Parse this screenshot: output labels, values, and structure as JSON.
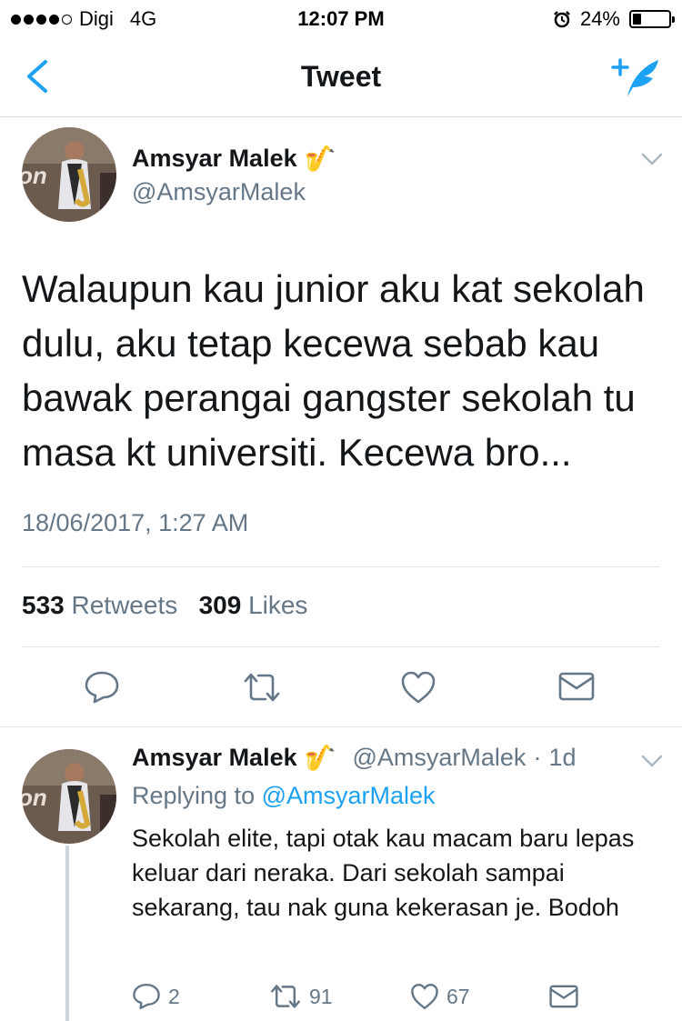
{
  "status_bar": {
    "carrier": "Digi",
    "network": "4G",
    "time": "12:07 PM",
    "battery_percent": "24%",
    "battery_level": 0.24,
    "signal_bars_filled": 4,
    "signal_bars_total": 5
  },
  "nav": {
    "title": "Tweet",
    "back_icon": "chevron-left-icon",
    "compose_icon": "compose-tweet-icon",
    "accent_color": "#1da1f2"
  },
  "main_tweet": {
    "author_name": "Amsyar Malek",
    "author_emoji": "🎷",
    "handle": "@AmsyarMalek",
    "text": "Walaupun kau junior aku kat sekolah dulu, aku tetap kecewa sebab kau bawak perangai gangster sekolah tu masa kt universiti. Kecewa bro...",
    "timestamp": "18/06/2017, 1:27 AM",
    "retweets_count": "533",
    "retweets_label": "Retweets",
    "likes_count": "309",
    "likes_label": "Likes"
  },
  "reply_tweet": {
    "author_name": "Amsyar Malek",
    "author_emoji": "🎷",
    "handle": "@AmsyarMalek",
    "separator": "·",
    "age": "1d",
    "replying_prefix": "Replying to",
    "replying_to": "@AmsyarMalek",
    "text": "Sekolah elite, tapi otak kau macam baru lepas keluar dari neraka. Dari sekolah sampai sekarang, tau nak guna kekerasan je. Bodoh",
    "reply_count": "2",
    "retweet_count": "91",
    "like_count": "67"
  }
}
